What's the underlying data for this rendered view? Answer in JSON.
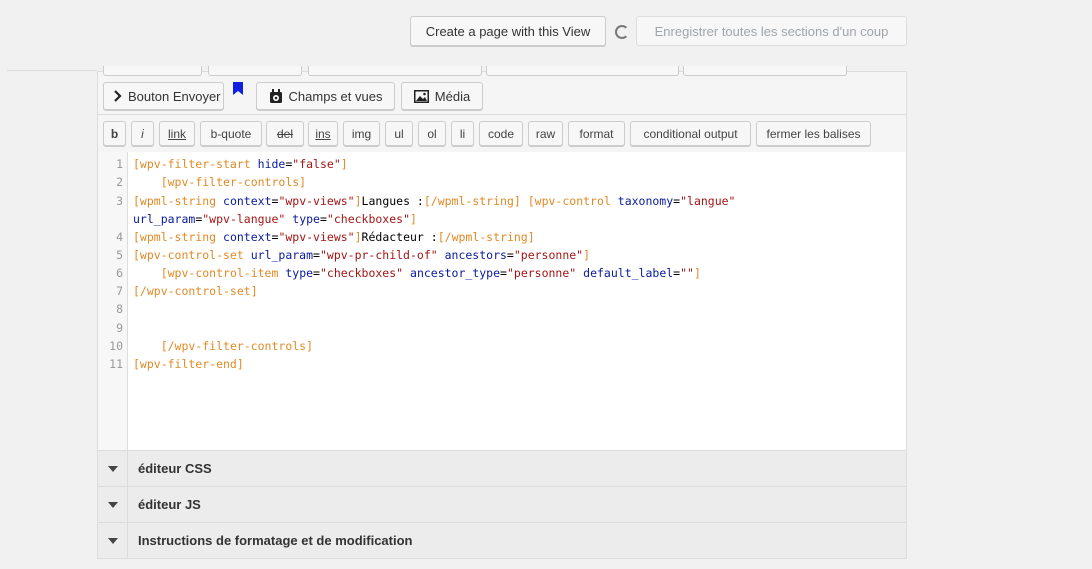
{
  "header": {
    "create_button": "Create a page with this View",
    "save_all_button": "Enregistrer toutes les sections d'un coup"
  },
  "toolbar": {
    "bouton_envoyer": "Bouton Envoyer",
    "champs_vues": "Champs et vues",
    "media": "Média"
  },
  "quicktags": [
    "b",
    "i",
    "link",
    "b-quote",
    "del",
    "ins",
    "img",
    "ul",
    "ol",
    "li",
    "code",
    "raw",
    "format",
    "conditional output",
    "fermer les balises"
  ],
  "code": {
    "line_numbers": [
      "1",
      "2",
      "3",
      "4",
      "5",
      "6",
      "7",
      "8",
      "9",
      "10",
      "11"
    ],
    "tokens": {
      "l1_tag": "[wpv-filter-start",
      "l1_attr": "hide",
      "l1_val": "\"false\"",
      "l1_close": "]",
      "l2_tag": "[wpv-filter-controls]",
      "l3_tag": "[wpml-string",
      "l3_attr": "context",
      "l3_val": "\"wpv-views\"",
      "l3_close": "]",
      "l3_text": "Langues :",
      "l3_end": "[/wpml-string]",
      "l3_tag2": "[wpv-control",
      "l3_attr2": "taxonomy",
      "l3_val2": "\"langue\"",
      "l3b_attr1": "url_param",
      "l3b_val1": "\"wpv-langue\"",
      "l3b_attr2": "type",
      "l3b_val2": "\"checkboxes\"",
      "l3b_close": "]",
      "l4_tag": "[wpml-string",
      "l4_attr": "context",
      "l4_val": "\"wpv-views\"",
      "l4_close": "]",
      "l4_text": "Rédacteur :",
      "l4_end": "[/wpml-string]",
      "l5_tag": "[wpv-control-set",
      "l5_attr1": "url_param",
      "l5_val1": "\"wpv-pr-child-of\"",
      "l5_attr2": "ancestors",
      "l5_val2": "\"personne\"",
      "l5_close": "]",
      "l6_tag": "[wpv-control-item",
      "l6_attr1": "type",
      "l6_val1": "\"checkboxes\"",
      "l6_attr2": "ancestor_type",
      "l6_val2": "\"personne\"",
      "l6_attr3": "default_label",
      "l6_val3": "\"\"",
      "l6_close": "]",
      "l7_tag": "[/wpv-control-set]",
      "l10_tag": "[/wpv-filter-controls]",
      "l11_tag": "[wpv-filter-end]",
      "eq": "="
    }
  },
  "sections": [
    "éditeur CSS",
    "éditeur JS",
    "Instructions de formatage et de modification"
  ]
}
